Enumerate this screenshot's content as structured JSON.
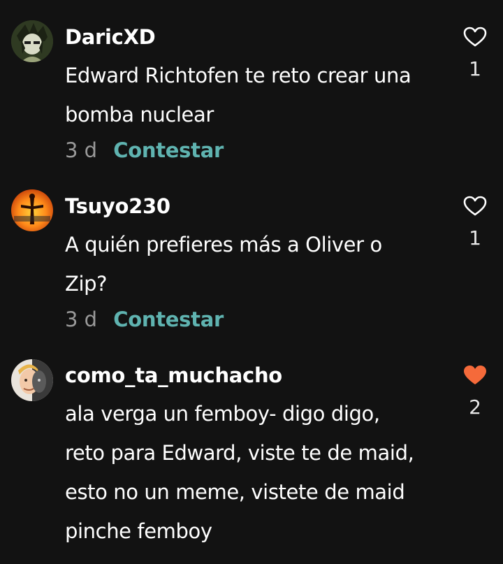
{
  "colors": {
    "background": "#121212",
    "reply_accent": "#5fb3b0",
    "liked_heart": "#f56a3a"
  },
  "comments": [
    {
      "username": "DaricXD",
      "lines": [
        "Edward Richtofen te reto crear una",
        "bomba nuclear"
      ],
      "age": "3 d",
      "reply_label": "Contestar",
      "likes": "1",
      "liked": false,
      "avatar_icon": "avatar-anime-character-icon"
    },
    {
      "username": "Tsuyo230",
      "lines": [
        "A quién prefieres más a Oliver o",
        "Zip?"
      ],
      "age": "3 d",
      "reply_label": "Contestar",
      "likes": "1",
      "liked": false,
      "avatar_icon": "avatar-sunset-figure-icon"
    },
    {
      "username": "como_ta_muchacho",
      "lines": [
        "ala verga un femboy- digo digo,",
        "reto para Edward, viste te de maid,",
        "esto no un meme, vistete de maid",
        "pinche femboy"
      ],
      "likes": "2",
      "liked": true,
      "avatar_icon": "avatar-split-face-icon"
    }
  ]
}
